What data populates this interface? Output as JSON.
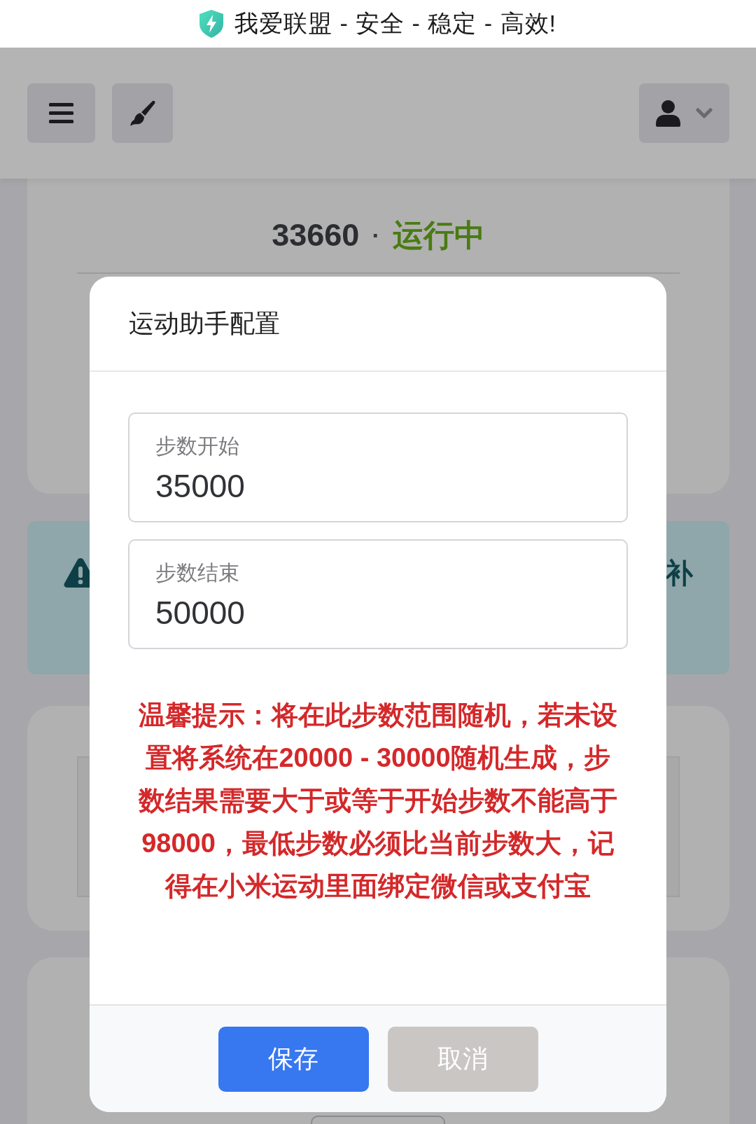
{
  "banner": {
    "title": "我爱联盟 - 安全 - 稳定 - 高效!"
  },
  "status_card": {
    "steps": "33660",
    "separator": "·",
    "status": "运行中"
  },
  "alert": {
    "text": "补"
  },
  "modal": {
    "title": "运动助手配置",
    "fields": [
      {
        "label": "步数开始",
        "value": "35000"
      },
      {
        "label": "步数结束",
        "value": "50000"
      }
    ],
    "notice": "温馨提示：将在此步数范围随机，若未设置将系统在20000 - 30000随机生成，步数结果需要大于或等于开始步数不能高于98000，最低步数必须比当前步数大，记得在小米运动里面绑定微信或支付宝",
    "buttons": [
      {
        "label": "保存",
        "kind": "primary"
      },
      {
        "label": "取消",
        "kind": "secondary"
      }
    ]
  }
}
